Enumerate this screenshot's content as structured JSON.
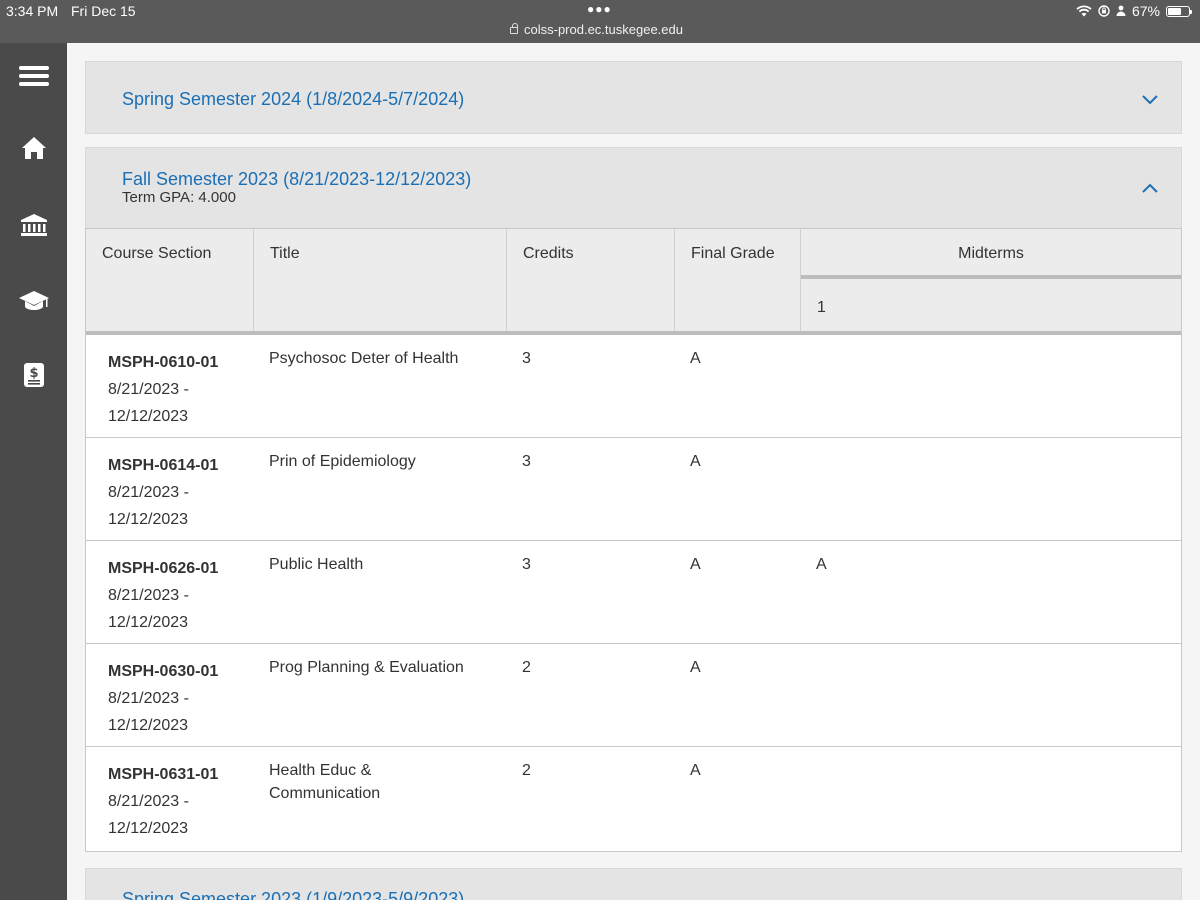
{
  "status_bar": {
    "time": "3:34 PM",
    "date": "Fri Dec 15",
    "url": "colss-prod.ec.tuskegee.edu",
    "battery": "67%",
    "battery_level": 0.67
  },
  "nav_rail": {
    "items": [
      {
        "icon": "menu-icon"
      },
      {
        "icon": "home-icon"
      },
      {
        "icon": "institution-icon"
      },
      {
        "icon": "graduation-cap-icon"
      },
      {
        "icon": "billing-icon"
      }
    ]
  },
  "terms": [
    {
      "title": "Spring Semester 2024 (1/8/2024-5/7/2024)",
      "expanded": false
    },
    {
      "title": "Fall Semester 2023 (8/21/2023-12/12/2023)",
      "gpa": "Term GPA: 4.000",
      "expanded": true
    },
    {
      "title": "Spring Semester 2023 (1/9/2023-5/9/2023)",
      "expanded": false
    }
  ],
  "table": {
    "headers": {
      "section": "Course Section",
      "title": "Title",
      "credits": "Credits",
      "grade": "Final Grade",
      "midterms": "Midterms",
      "midterm_1": "1"
    },
    "rows": [
      {
        "section": "MSPH-0610-01",
        "start": "8/21/2023 -",
        "end": "12/12/2023",
        "title": "Psychosoc Deter of Health",
        "credits": "3",
        "grade": "A",
        "midterm": ""
      },
      {
        "section": "MSPH-0614-01",
        "start": "8/21/2023 -",
        "end": "12/12/2023",
        "title": "Prin of Epidemiology",
        "credits": "3",
        "grade": "A",
        "midterm": ""
      },
      {
        "section": "MSPH-0626-01",
        "start": "8/21/2023 -",
        "end": "12/12/2023",
        "title": "Public Health",
        "credits": "3",
        "grade": "A",
        "midterm": "A"
      },
      {
        "section": "MSPH-0630-01",
        "start": "8/21/2023 -",
        "end": "12/12/2023",
        "title": "Prog Planning & Evaluation",
        "credits": "2",
        "grade": "A",
        "midterm": ""
      },
      {
        "section": "MSPH-0631-01",
        "start": "8/21/2023 -",
        "end": "12/12/2023",
        "title": "Health Educ & Communication",
        "credits": "2",
        "grade": "A",
        "midterm": ""
      }
    ]
  },
  "colors": {
    "link": "#1b6fb4",
    "rail": "#4a4a4a",
    "status_bar": "#5a5a5a"
  }
}
